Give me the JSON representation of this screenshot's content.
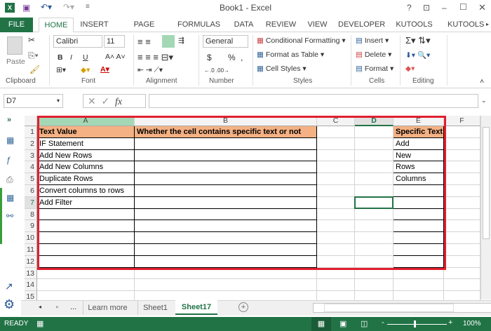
{
  "title": "Book1 - Excel",
  "title_controls": [
    "?",
    "⊡",
    "–",
    "☐",
    "✕"
  ],
  "tabs": [
    "FILE",
    "HOME",
    "INSERT",
    "PAGE LAYOUT",
    "FORMULAS",
    "DATA",
    "REVIEW",
    "VIEW",
    "DEVELOPER",
    "KUTOOLS ™",
    "KUTOOLS"
  ],
  "ribbon": {
    "paste": "Paste",
    "font_name": "Calibri",
    "font_size": "11",
    "bold": "B",
    "italic": "I",
    "underline": "U",
    "number_format": "General",
    "currency": "$",
    "percent": "%",
    "comma": ",",
    "cond_format": "Conditional Formatting",
    "format_table": "Format as Table",
    "cell_styles": "Cell Styles",
    "insert": "Insert",
    "delete": "Delete",
    "format": "Format",
    "groups": [
      "Clipboard",
      "Font",
      "Alignment",
      "Number",
      "Styles",
      "Cells",
      "Editing"
    ]
  },
  "formula": {
    "name_box": "D7",
    "fx": "fx",
    "value": ""
  },
  "columns": [
    "A",
    "B",
    "C",
    "D",
    "E",
    "F"
  ],
  "rows": [
    "1",
    "2",
    "3",
    "4",
    "5",
    "6",
    "7",
    "8",
    "9",
    "10",
    "11",
    "12",
    "13",
    "14",
    "15"
  ],
  "cells": {
    "A": [
      "Text Value",
      "IF Statement",
      "Add New Rows",
      "Add New Columns",
      "Duplicate Rows",
      "Convert columns to rows",
      "Add Filter"
    ],
    "B": [
      "Whether the cell contains specific text or not"
    ],
    "E": [
      "Specific Text",
      "Add",
      "New",
      "Rows",
      "Columns"
    ]
  },
  "selected_cell": "D7",
  "sheets": {
    "nav_more": "...",
    "items": [
      "Learn more",
      "Sheet1",
      "Sheet17"
    ],
    "active": "Sheet17"
  },
  "status": {
    "text": "READY",
    "zoom": "100%"
  },
  "colors": {
    "excel_green": "#217346",
    "header_fill": "#f4b183",
    "highlight": "#e02030"
  }
}
